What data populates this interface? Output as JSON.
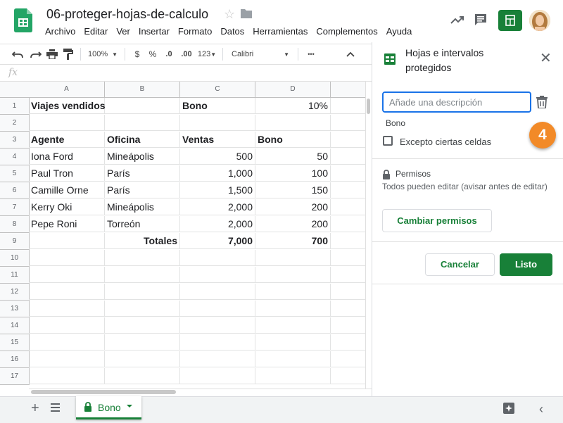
{
  "doc": {
    "title": "06-proteger-hojas-de-calculo"
  },
  "menu": [
    "Archivo",
    "Editar",
    "Ver",
    "Insertar",
    "Formato",
    "Datos",
    "Herramientas",
    "Complementos",
    "Ayuda"
  ],
  "toolbar": {
    "zoom": "100%",
    "currency": "$",
    "percent": "%",
    "dec_decrease": ".0",
    "dec_increase": ".00",
    "format_more": "123",
    "font": "Calibri",
    "more": "•••"
  },
  "formula": {
    "fx": "fx"
  },
  "columns": [
    "A",
    "B",
    "C",
    "D"
  ],
  "rows": [
    "1",
    "2",
    "3",
    "4",
    "5",
    "6",
    "7",
    "8",
    "9",
    "10",
    "11",
    "12",
    "13",
    "14",
    "15",
    "16",
    "17"
  ],
  "cells": {
    "A1": "Viajes vendidos",
    "C1": "Bono",
    "D1": "10%",
    "A3": "Agente",
    "B3": "Oficina",
    "C3": "Ventas",
    "D3": "Bono",
    "A4": "Iona Ford",
    "B4": "Mineápolis",
    "C4": "500",
    "D4": "50",
    "A5": "Paul Tron",
    "B5": "París",
    "C5": "1,000",
    "D5": "100",
    "A6": "Camille Orne",
    "B6": "París",
    "C6": "1,500",
    "D6": "150",
    "A7": "Kerry Oki",
    "B7": "Mineápolis",
    "C7": "2,000",
    "D7": "200",
    "A8": "Pepe Roni",
    "B8": "Torreón",
    "C8": "2,000",
    "D8": "200",
    "B9": "Totales",
    "C9": "7,000",
    "D9": "700"
  },
  "sheet": {
    "tab_name": "Bono"
  },
  "panel": {
    "title": "Hojas e intervalos protegidos",
    "description_placeholder": "Añade una descripción",
    "range_name": "Bono",
    "except_label": "Excepto ciertas celdas",
    "permissions_title": "Permisos",
    "permissions_desc": "Todos pueden editar (avisar antes de editar)",
    "change_permissions": "Cambiar permisos",
    "cancel": "Cancelar",
    "done": "Listo",
    "step_badge": "4"
  },
  "colors": {
    "accent_green": "#188038",
    "focus_blue": "#1a73e8",
    "badge_orange": "#f28a28"
  }
}
